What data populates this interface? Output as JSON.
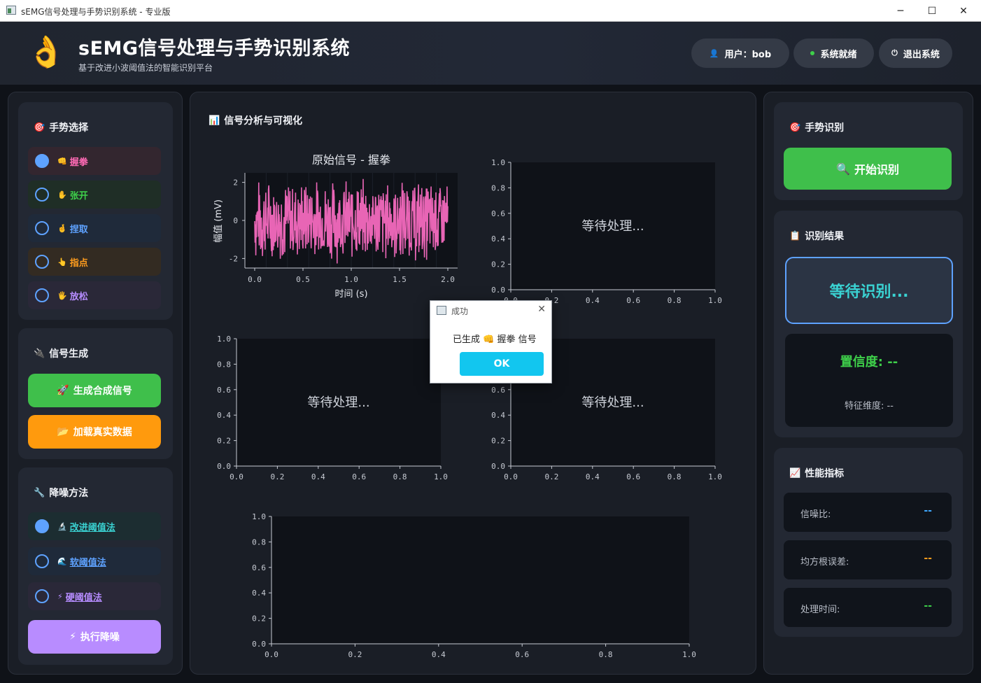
{
  "window": {
    "title": "sEMG信号处理与手势识别系统 - 专业版",
    "minimize": "─",
    "maximize": "☐",
    "close": "✕"
  },
  "header": {
    "logo": "👌",
    "title": "sEMG信号处理与手势识别系统",
    "subtitle": "基于改进小波阈值法的智能识别平台",
    "user_icon": "👤",
    "user_label": "用户：bob",
    "status_label": "系统就绪",
    "logout_icon": "⏻",
    "logout_label": "退出系统"
  },
  "left": {
    "gesture_section": {
      "icon": "🎯",
      "title": "手势选择"
    },
    "gestures": [
      {
        "icon": "👊",
        "label": "握拳",
        "checked": true,
        "color": "#ff6ab5",
        "bg": "#33262f"
      },
      {
        "icon": "✋",
        "label": "张开",
        "checked": false,
        "color": "#3ecf4a",
        "bg": "#1f2e26"
      },
      {
        "icon": "🤞",
        "label": "捏取",
        "checked": false,
        "color": "#5ea2ff",
        "bg": "#1f2a3a"
      },
      {
        "icon": "👆",
        "label": "指点",
        "checked": false,
        "color": "#ff9d1e",
        "bg": "#332b22"
      },
      {
        "icon": "🖐",
        "label": "放松",
        "checked": false,
        "color": "#b68cff",
        "bg": "#2a2838"
      }
    ],
    "signal_section": {
      "icon": "🔌",
      "title": "信号生成"
    },
    "generate_button": {
      "icon": "🚀",
      "label": "生成合成信号"
    },
    "load_button": {
      "icon": "📂",
      "label": "加载真实数据"
    },
    "denoise_section": {
      "icon": "🔧",
      "title": "降噪方法"
    },
    "methods": [
      {
        "icon": "🔬",
        "label": "改进阈值法",
        "checked": true,
        "color": "#3ad2d2",
        "bg": "#1c2d31"
      },
      {
        "icon": "🌊",
        "label": "软阈值法",
        "checked": false,
        "color": "#5ea2ff",
        "bg": "#1f2a3a"
      },
      {
        "icon": "⚡",
        "label": "硬阈值法",
        "checked": false,
        "color": "#b68cff",
        "bg": "#2a2838"
      }
    ],
    "denoise_button": {
      "icon": "⚡",
      "label": "执行降噪"
    }
  },
  "center": {
    "section": {
      "icon": "📊",
      "title": "信号分析与可视化"
    },
    "waiting_text": "等待处理...",
    "ticks_unit": [
      "0.0",
      "0.2",
      "0.4",
      "0.6",
      "0.8",
      "1.0"
    ]
  },
  "chart_data": [
    {
      "type": "line",
      "title": "原始信号 - 握拳",
      "xlabel": "时间 (s)",
      "ylabel": "幅值 (mV)",
      "xlim": [
        0,
        2.0
      ],
      "ylim": [
        -2.5,
        2.5
      ],
      "x_ticks": [
        "0.0",
        "0.5",
        "1.0",
        "1.5",
        "2.0"
      ],
      "y_ticks": [
        "-2",
        "0",
        "2"
      ],
      "series": [
        {
          "color": "#e865b5",
          "amplitude_range": [
            -2.3,
            2.3
          ]
        }
      ]
    },
    {
      "type": "line",
      "xlim": [
        0,
        1
      ],
      "ylim": [
        0,
        1
      ],
      "placeholder": "等待处理..."
    },
    {
      "type": "line",
      "xlim": [
        0,
        1
      ],
      "ylim": [
        0,
        1
      ],
      "placeholder": "等待处理..."
    },
    {
      "type": "line",
      "xlim": [
        0,
        1
      ],
      "ylim": [
        0,
        1
      ],
      "placeholder": "等待处理..."
    },
    {
      "type": "line",
      "xlim": [
        0,
        1
      ],
      "ylim": [
        0,
        1
      ]
    }
  ],
  "dialog": {
    "title": "成功",
    "close": "✕",
    "message": "已生成 👊 握拳 信号",
    "ok": "OK"
  },
  "right": {
    "recognize_section": {
      "icon": "🎯",
      "title": "手势识别"
    },
    "start_button": {
      "icon": "🔍",
      "label": "开始识别"
    },
    "result_section": {
      "icon": "📋",
      "title": "识别结果"
    },
    "result_value": "等待识别...",
    "confidence": "置信度: --",
    "feature_dim": "特征维度: --",
    "perf_section": {
      "icon": "📈",
      "title": "性能指标"
    },
    "metrics": [
      {
        "label": "信噪比:",
        "value": "--",
        "color": "#3fa9ff"
      },
      {
        "label": "均方根误差:",
        "value": "--",
        "color": "#ff9d1e"
      },
      {
        "label": "处理时间:",
        "value": "--",
        "color": "#3ecf4a"
      }
    ]
  }
}
